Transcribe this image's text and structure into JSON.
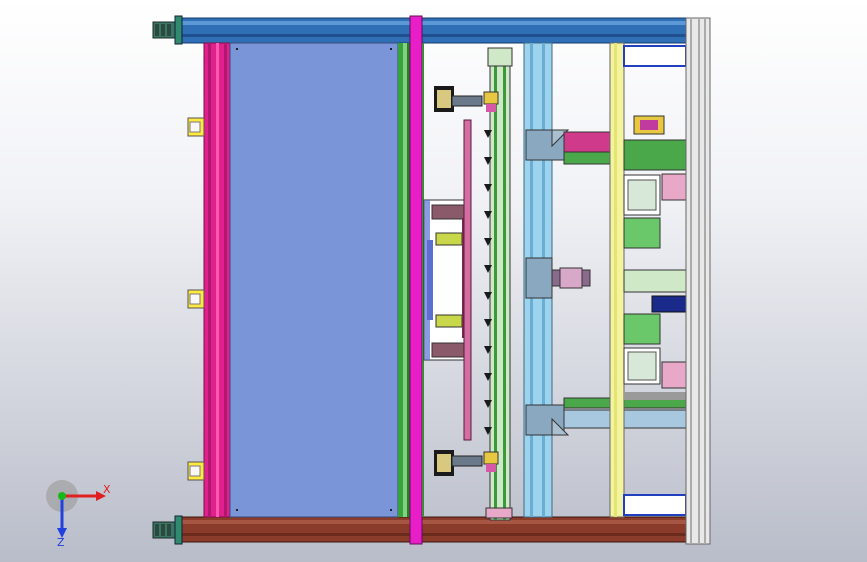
{
  "viewport": {
    "model": "machine-assembly-top-view",
    "background_colors": {
      "top": "#ffffff",
      "bottom": "#b9bdc9"
    }
  },
  "triad": {
    "x_label": "X",
    "z_label": "Z",
    "colors": {
      "x": "#e02020",
      "y": "#18b818",
      "z": "#2040e0"
    }
  },
  "colors": {
    "top_rail": "#2f6fb6",
    "bottom_rail": "#8a3b2a",
    "main_panel": "#7b96d8",
    "magenta": "#e0208c",
    "green": "#3aa23a",
    "light_blue": "#9ed3ee",
    "yellow": "#ffe840"
  }
}
